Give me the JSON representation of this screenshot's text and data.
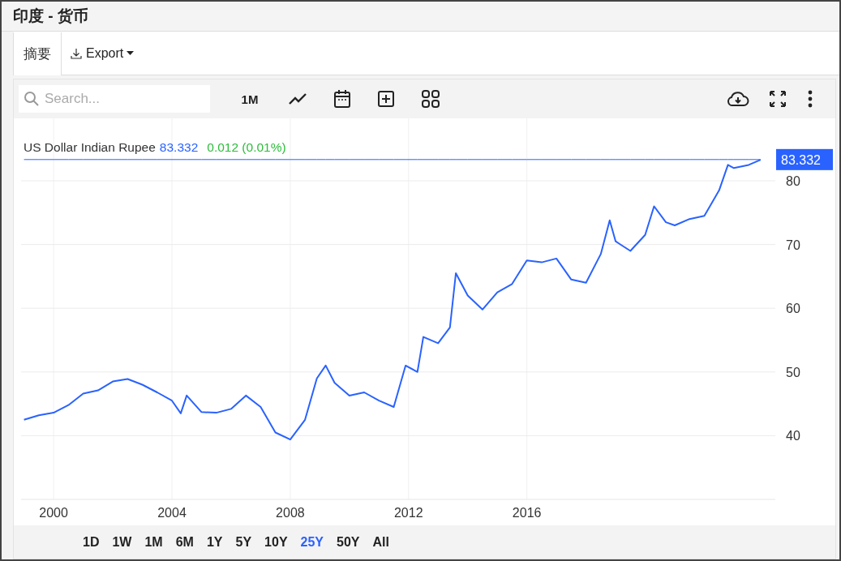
{
  "window": {
    "title": "印度 - 货币"
  },
  "tabs": [
    {
      "label": "摘要",
      "selected": true
    }
  ],
  "export": {
    "label": "Export"
  },
  "toolbar": {
    "search": {
      "placeholder": "Search..."
    },
    "interval": "1M"
  },
  "legend": {
    "name": "US Dollar Indian Rupee",
    "price": "83.332",
    "change": "0.012 (0.01%)"
  },
  "chart_data": {
    "type": "line",
    "x": [
      1999.0,
      1999.5,
      2000.0,
      2000.5,
      2001.0,
      2001.5,
      2002.0,
      2002.5,
      2003.0,
      2003.5,
      2004.0,
      2004.3,
      2004.5,
      2005.0,
      2005.5,
      2006.0,
      2006.5,
      2007.0,
      2007.5,
      2008.0,
      2008.5,
      2008.9,
      2009.2,
      2009.5,
      2010.0,
      2010.5,
      2011.0,
      2011.5,
      2011.9,
      2012.3,
      2012.5,
      2013.0,
      2013.4,
      2013.6,
      2014.0,
      2014.5,
      2015.0,
      2015.5,
      2016.0,
      2016.5,
      2017.0,
      2017.5,
      2018.0,
      2018.5,
      2018.8,
      2019.0,
      2019.5,
      2020.0,
      2020.3,
      2020.7,
      2021.0,
      2021.5,
      2022.0,
      2022.5,
      2022.8,
      2023.0,
      2023.5,
      2023.9
    ],
    "series": [
      {
        "color": "#2962ff",
        "values": [
          42.5,
          43.2,
          43.6,
          44.8,
          46.6,
          47.1,
          48.5,
          48.9,
          48.0,
          46.8,
          45.5,
          43.5,
          46.3,
          43.7,
          43.6,
          44.2,
          46.3,
          44.5,
          40.5,
          39.4,
          42.5,
          49.0,
          51.0,
          48.3,
          46.3,
          46.8,
          45.5,
          44.5,
          51.0,
          50.0,
          55.5,
          54.5,
          57.0,
          65.5,
          62.0,
          59.8,
          62.5,
          63.8,
          67.5,
          67.2,
          67.8,
          64.5,
          64.0,
          68.5,
          73.8,
          70.5,
          69.0,
          71.5,
          76.0,
          73.5,
          73.0,
          74.0,
          74.5,
          78.5,
          82.5,
          82.0,
          82.5,
          83.3
        ]
      },
      {
        "name": "83.332",
        "color": "#2962ff",
        "values": [
          83.332,
          83.332,
          83.332,
          83.332,
          83.332,
          83.332,
          83.332,
          83.332,
          83.332,
          83.332,
          83.332,
          83.332,
          83.332,
          83.332,
          83.332,
          83.332,
          83.332,
          83.332,
          83.332,
          83.332,
          83.332,
          83.332,
          83.332,
          83.332,
          83.332,
          83.332,
          83.332,
          83.332,
          83.332,
          83.332,
          83.332,
          83.332,
          83.332,
          83.332,
          83.332,
          83.332,
          83.332,
          83.332,
          83.332,
          83.332,
          83.332,
          83.332,
          83.332,
          83.332,
          83.332,
          83.332,
          83.332,
          83.332,
          83.332,
          83.332,
          83.332,
          83.332,
          83.332,
          83.332,
          83.332,
          83.332,
          83.332,
          83.332
        ]
      }
    ],
    "xlim": [
      1998.9,
      2024.4
    ],
    "ylim": [
      30,
      89.8
    ],
    "grid": true,
    "xticks": [
      2000,
      2004,
      2008,
      2012,
      2016
    ],
    "yticks": [
      40,
      50,
      60,
      70,
      80
    ]
  },
  "ranges": [
    {
      "label": "1D",
      "selected": false
    },
    {
      "label": "1W",
      "selected": false
    },
    {
      "label": "1M",
      "selected": false
    },
    {
      "label": "6M",
      "selected": false
    },
    {
      "label": "1Y",
      "selected": false
    },
    {
      "label": "5Y",
      "selected": false
    },
    {
      "label": "10Y",
      "selected": false
    },
    {
      "label": "25Y",
      "selected": true
    },
    {
      "label": "50Y",
      "selected": false
    },
    {
      "label": "All",
      "selected": false
    }
  ]
}
